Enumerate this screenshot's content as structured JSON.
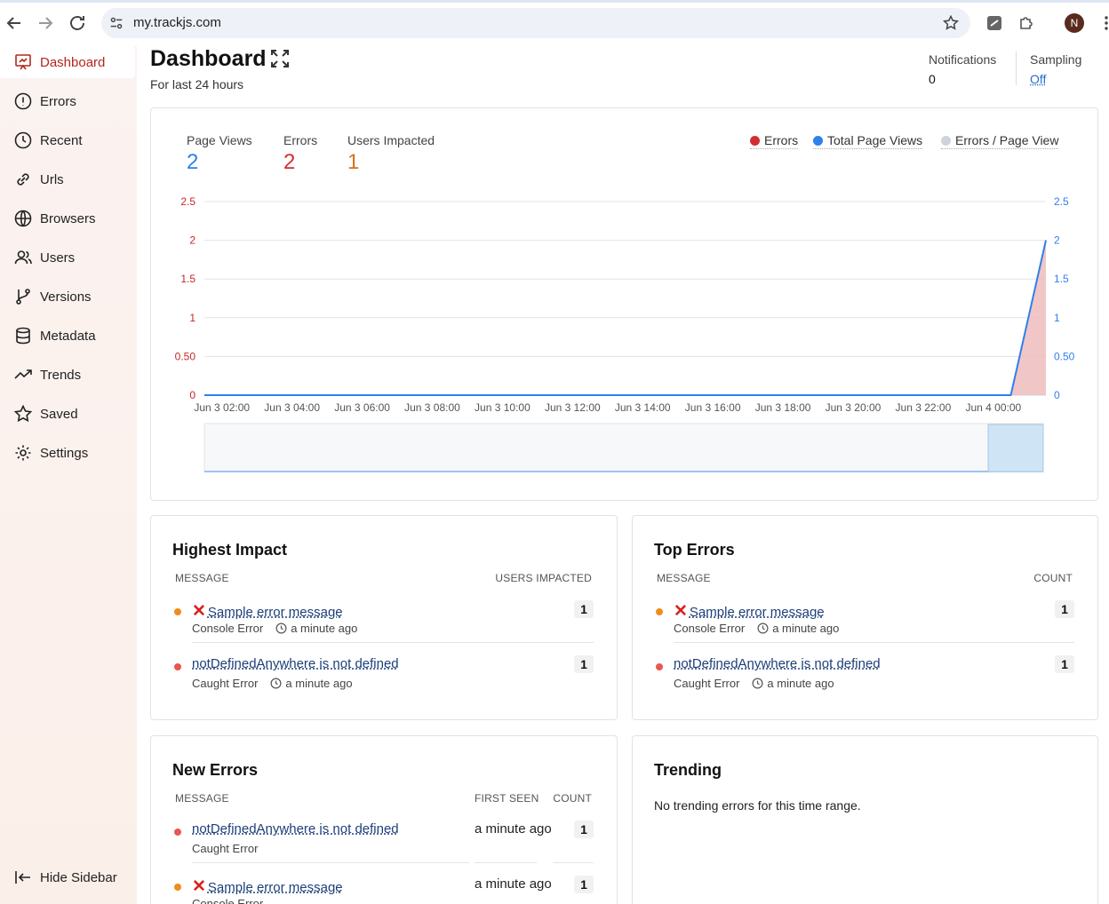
{
  "browser": {
    "url": "my.trackjs.com",
    "profile_initial": "N"
  },
  "sidebar": {
    "items": [
      {
        "label": "Dashboard",
        "icon": "presentation-chart-icon",
        "active": true
      },
      {
        "label": "Errors",
        "icon": "alert-circle-icon"
      },
      {
        "label": "Recent",
        "icon": "clock-icon"
      },
      {
        "label": "Urls",
        "icon": "link-icon"
      },
      {
        "label": "Browsers",
        "icon": "globe-icon"
      },
      {
        "label": "Users",
        "icon": "users-icon"
      },
      {
        "label": "Versions",
        "icon": "git-branch-icon"
      },
      {
        "label": "Metadata",
        "icon": "database-icon"
      },
      {
        "label": "Trends",
        "icon": "trend-line-icon"
      },
      {
        "label": "Saved",
        "icon": "star-icon"
      },
      {
        "label": "Settings",
        "icon": "gear-icon"
      }
    ],
    "hide_label": "Hide Sidebar"
  },
  "header": {
    "title": "Dashboard",
    "subtitle": "For last 24 hours",
    "notifications_label": "Notifications",
    "notifications_value": "0",
    "sampling_label": "Sampling",
    "sampling_value": "Off"
  },
  "kpis": {
    "page_views_label": "Page Views",
    "page_views_value": "2",
    "errors_label": "Errors",
    "errors_value": "2",
    "users_label": "Users Impacted",
    "users_value": "1"
  },
  "legend": {
    "errors": "Errors",
    "page_views": "Total Page Views",
    "ratio": "Errors / Page View"
  },
  "colors": {
    "accent_red": "#b3261e",
    "errors": "#d32f2f",
    "page_views": "#2f80ed",
    "ratio": "#cfd3da",
    "users_orange": "#d4731a",
    "bullet_orange": "#f08c1b",
    "bullet_red": "#e9574f"
  },
  "chart_data": {
    "type": "area",
    "x_labels": [
      "Jun 3 02:00",
      "Jun 3 04:00",
      "Jun 3 06:00",
      "Jun 3 08:00",
      "Jun 3 10:00",
      "Jun 3 12:00",
      "Jun 3 14:00",
      "Jun 3 16:00",
      "Jun 3 18:00",
      "Jun 3 20:00",
      "Jun 3 22:00",
      "Jun 4 00:00"
    ],
    "y_left_ticks": [
      "2.5",
      "2",
      "1.5",
      "1",
      "0.50",
      "0"
    ],
    "y_right_ticks": [
      "2.5",
      "2",
      "1.5",
      "1",
      "0.50",
      "0"
    ],
    "ylim": [
      0,
      2.5
    ],
    "x_range_hours": [
      1.5,
      25.5
    ],
    "series": [
      {
        "name": "Errors",
        "points": [
          [
            1.5,
            0
          ],
          [
            24.5,
            0
          ],
          [
            25.5,
            2
          ]
        ]
      },
      {
        "name": "Total Page Views",
        "points": [
          [
            1.5,
            0
          ],
          [
            24.5,
            0
          ],
          [
            25.5,
            2
          ]
        ]
      }
    ],
    "legend": "top-right",
    "grid": true
  },
  "highest_impact": {
    "title": "Highest Impact",
    "col_message": "MESSAGE",
    "col_value": "USERS IMPACTED",
    "rows": [
      {
        "message": "Sample error message",
        "has_x": true,
        "type": "Console Error",
        "time": "a minute ago",
        "count": "1",
        "bullet": "orange"
      },
      {
        "message": "notDefinedAnywhere is not defined",
        "has_x": false,
        "type": "Caught Error",
        "time": "a minute ago",
        "count": "1",
        "bullet": "red"
      }
    ]
  },
  "top_errors": {
    "title": "Top Errors",
    "col_message": "MESSAGE",
    "col_value": "COUNT",
    "rows": [
      {
        "message": "Sample error message",
        "has_x": true,
        "type": "Console Error",
        "time": "a minute ago",
        "count": "1",
        "bullet": "orange"
      },
      {
        "message": "notDefinedAnywhere is not defined",
        "has_x": false,
        "type": "Caught Error",
        "time": "a minute ago",
        "count": "1",
        "bullet": "red"
      }
    ]
  },
  "new_errors": {
    "title": "New Errors",
    "col_message": "MESSAGE",
    "col_first_seen": "FIRST SEEN",
    "col_count": "COUNT",
    "rows": [
      {
        "message": "notDefinedAnywhere is not defined",
        "has_x": false,
        "type": "Caught Error",
        "first_seen": "a minute ago",
        "count": "1",
        "bullet": "red"
      },
      {
        "message": "Sample error message",
        "has_x": true,
        "type": "Console Error",
        "first_seen": "a minute ago",
        "count": "1",
        "bullet": "orange"
      }
    ]
  },
  "trending": {
    "title": "Trending",
    "empty": "No trending errors for this time range."
  }
}
